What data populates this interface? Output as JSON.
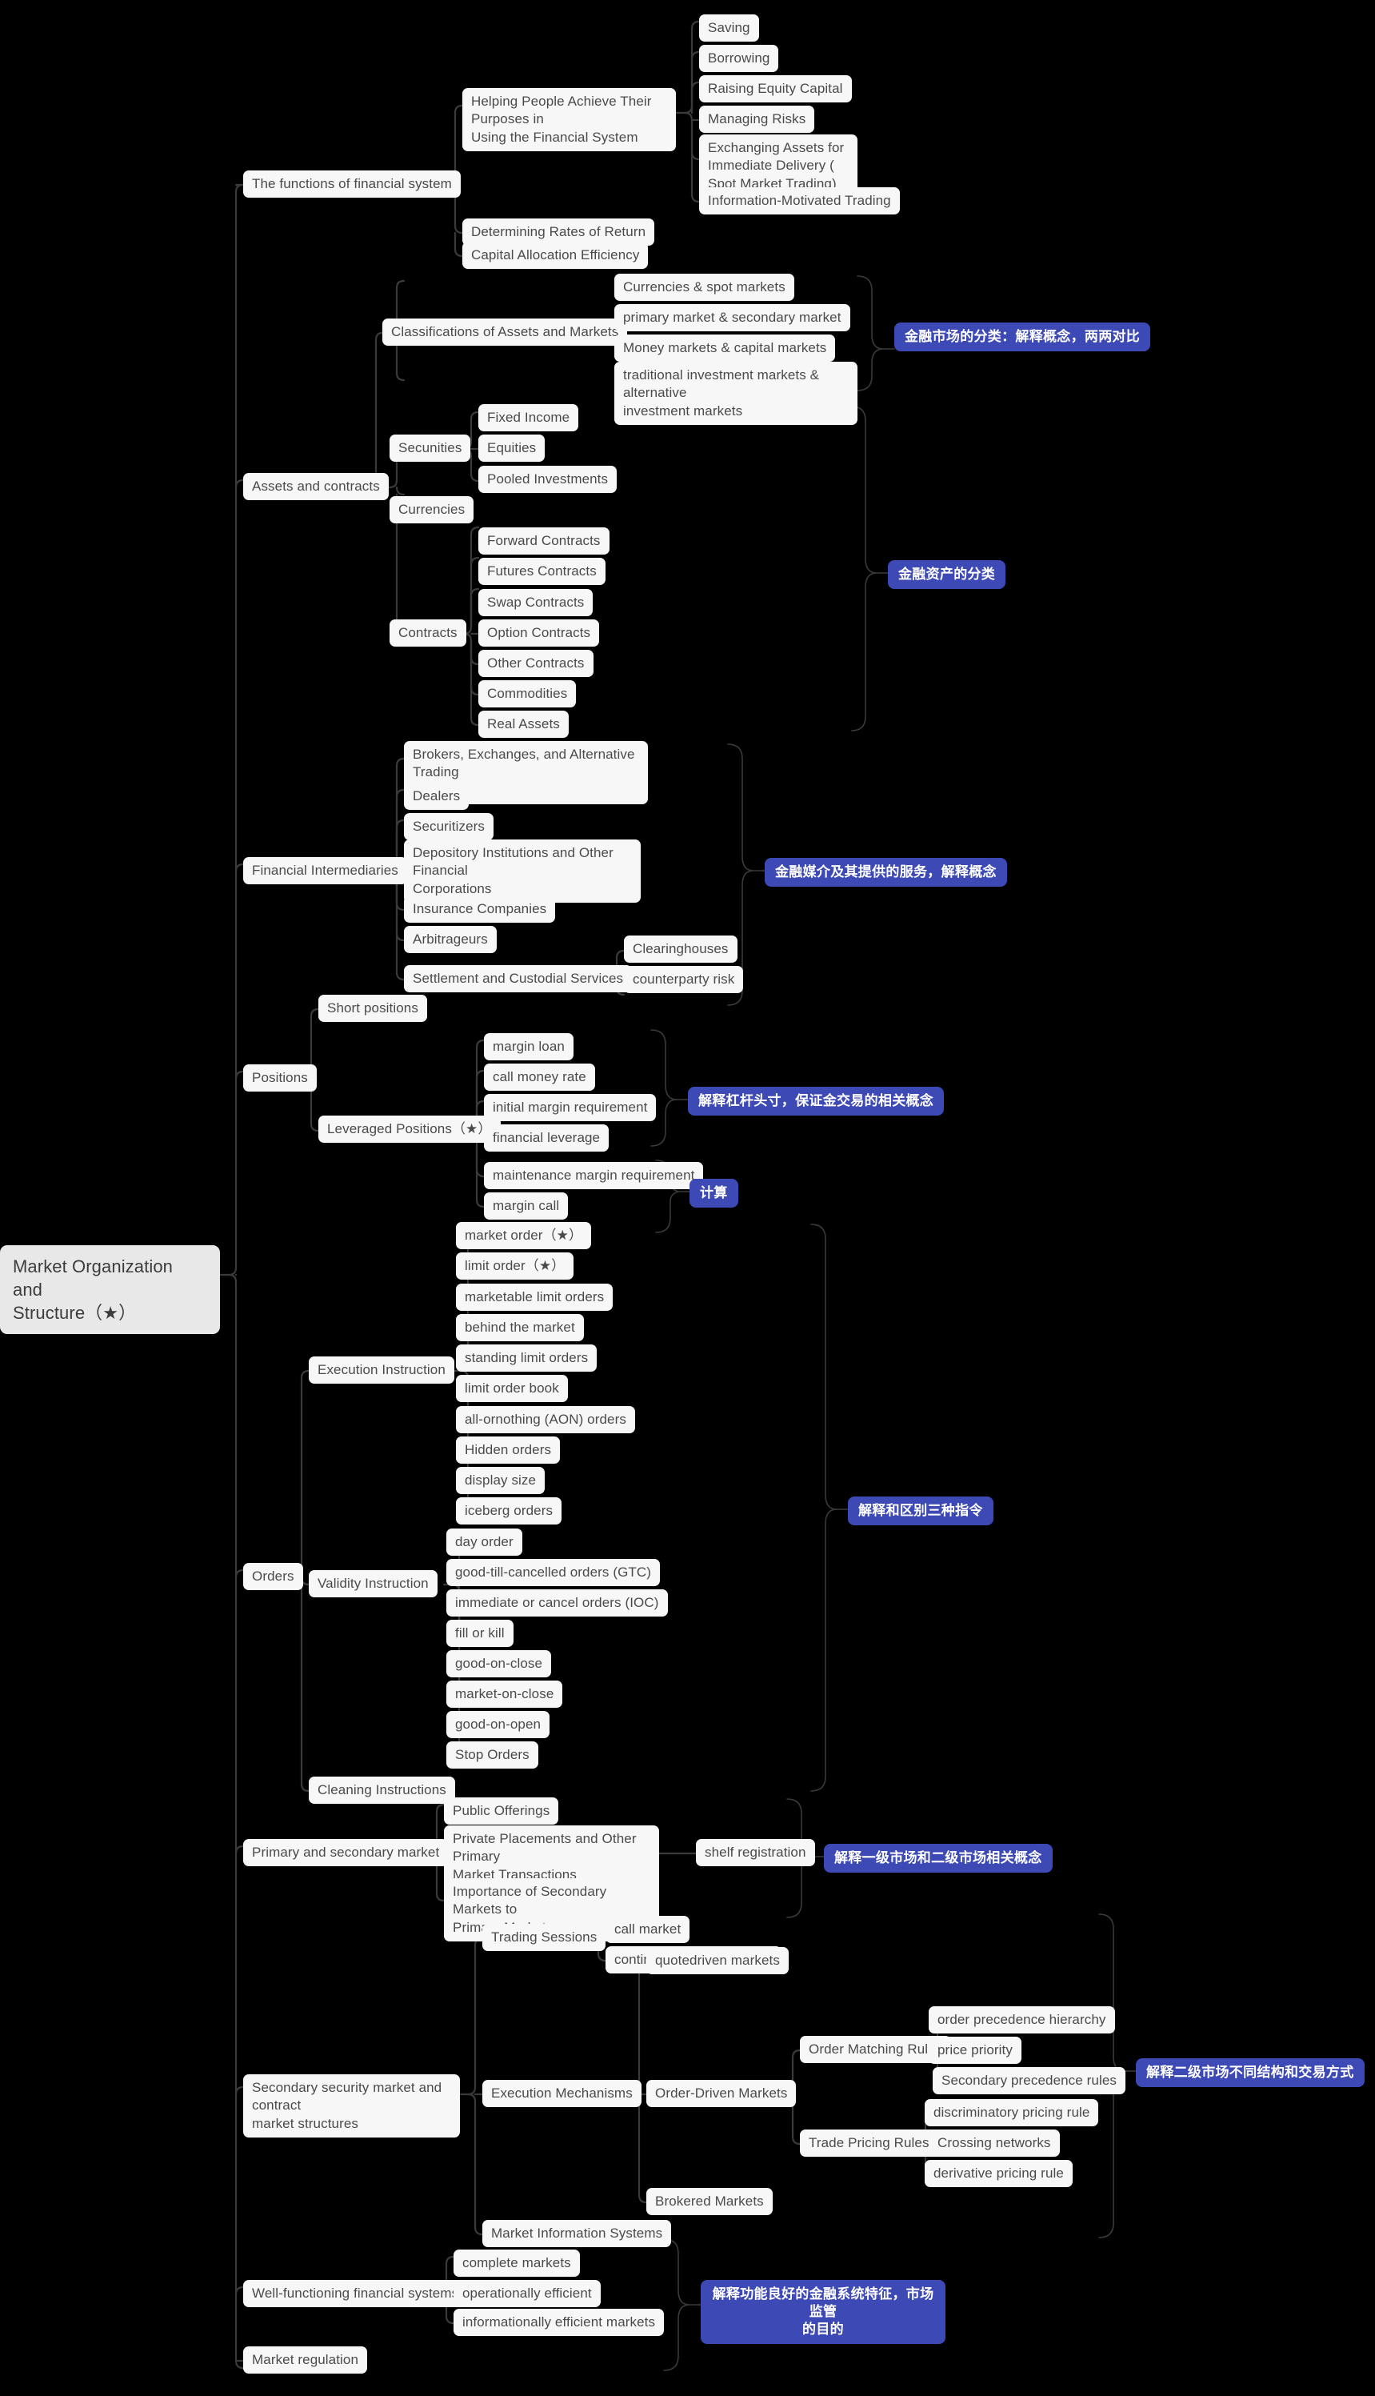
{
  "diagram": {
    "title": "Market Organization and Structure（★）",
    "type": "mindmap",
    "background_color": "#000000",
    "node_color": "#f7f7f7",
    "root_color": "#e8e8e8",
    "badge_color": "#3d49b5",
    "edge_color": "#3a3a3a"
  },
  "root": {
    "label": "Market Organization and\nStructure（★）"
  },
  "nodes": {
    "functions": {
      "label": "The functions of financial system"
    },
    "helping": {
      "label": "Helping People Achieve Their Purposes in\nUsing the Financial System"
    },
    "saving": {
      "label": "Saving"
    },
    "borrowing": {
      "label": "Borrowing"
    },
    "raising_equity": {
      "label": "Raising Equity Capital"
    },
    "managing_risks": {
      "label": "Managing Risks"
    },
    "exchanging": {
      "label": "Exchanging Assets for Immediate Delivery (\nSpot Market Trading)"
    },
    "info_trading": {
      "label": "Information-Motivated Trading"
    },
    "determining_rates": {
      "label": "Determining Rates of Return"
    },
    "capital_alloc": {
      "label": "Capital Allocation Efficiency"
    },
    "classifications": {
      "label": "Classifications of Assets and Markets"
    },
    "currencies_spot": {
      "label": "Currencies &  spot markets"
    },
    "primary_secondary": {
      "label": "primary market & secondary market"
    },
    "money_capital": {
      "label": "Money markets & capital markets"
    },
    "traditional_alt": {
      "label": "traditional investment markets & alternative\ninvestment markets"
    },
    "assets_contracts": {
      "label": "Assets and contracts"
    },
    "securities": {
      "label": "Secunities"
    },
    "fixed_income": {
      "label": "Fixed Income"
    },
    "equities": {
      "label": "Equities"
    },
    "pooled": {
      "label": "Pooled Investments"
    },
    "currencies": {
      "label": "Currencies"
    },
    "contracts": {
      "label": "Contracts"
    },
    "forward": {
      "label": "Forward Contracts"
    },
    "futures": {
      "label": "Futures Contracts"
    },
    "swap": {
      "label": "Swap Contracts"
    },
    "option": {
      "label": "Option Contracts"
    },
    "other_contracts": {
      "label": "Other Contracts"
    },
    "commodities": {
      "label": "Commodities"
    },
    "real_assets": {
      "label": "Real Assets"
    },
    "intermediaries": {
      "label": "Financial Intermediaries"
    },
    "brokers": {
      "label": "Brokers, Exchanges, and Alternative Trading\nSystems"
    },
    "dealers": {
      "label": "Dealers"
    },
    "securitizers": {
      "label": "Securitizers"
    },
    "depository": {
      "label": "Depository Institutions and Other Financial\nCorporations"
    },
    "insurance": {
      "label": "Insurance Companies"
    },
    "arbitrageurs": {
      "label": "Arbitrageurs"
    },
    "settlement": {
      "label": "Settlement and Custodial Services"
    },
    "clearinghouses": {
      "label": "Clearinghouses"
    },
    "counterparty": {
      "label": "counterparty risk"
    },
    "positions": {
      "label": "Positions"
    },
    "short_positions": {
      "label": "Short positions"
    },
    "leveraged": {
      "label": "Leveraged Positions（★）"
    },
    "margin_loan": {
      "label": "margin loan"
    },
    "call_money_rate": {
      "label": "call money rate"
    },
    "initial_margin": {
      "label": "initial margin requirement"
    },
    "fin_leverage": {
      "label": "financial leverage"
    },
    "maintenance_margin": {
      "label": "maintenance margin requirement"
    },
    "margin_call": {
      "label": "margin call"
    },
    "orders": {
      "label": "Orders"
    },
    "exec_instruction": {
      "label": "Execution Instruction"
    },
    "market_order": {
      "label": "market order（★）"
    },
    "limit_order": {
      "label": "limit order（★）"
    },
    "marketable_limit": {
      "label": "marketable limit orders"
    },
    "behind_market": {
      "label": "behind the market"
    },
    "standing_limit": {
      "label": "standing limit orders"
    },
    "limit_order_book": {
      "label": "limit order book"
    },
    "aon": {
      "label": "all-ornothing (AON) orders"
    },
    "hidden_orders": {
      "label": "Hidden orders"
    },
    "display_size": {
      "label": "display size"
    },
    "iceberg": {
      "label": "iceberg orders"
    },
    "validity_instruction": {
      "label": "Validity Instruction"
    },
    "day_order": {
      "label": "day order"
    },
    "gtc": {
      "label": "good-till-cancelled orders (GTC)"
    },
    "ioc": {
      "label": "immediate or cancel orders (IOC)"
    },
    "fill_or_kill": {
      "label": "fill or kill"
    },
    "good_on_close": {
      "label": "good-on-close"
    },
    "market_on_close": {
      "label": "market-on-close"
    },
    "good_on_open": {
      "label": "good-on-open"
    },
    "stop_orders": {
      "label": "Stop Orders"
    },
    "cleaning_instructions": {
      "label": "Cleaning Instructions"
    },
    "primary_sec_market": {
      "label": "Primary and secondary market"
    },
    "public_offerings": {
      "label": "Public Offerings"
    },
    "private_placements": {
      "label": "Private Placements and Other Primary\nMarket Transactions"
    },
    "shelf_registration": {
      "label": "shelf registration"
    },
    "importance_secondary": {
      "label": "Importance of Secondary Markets to\nPrimary Markets"
    },
    "secondary_structures": {
      "label": "Secondary security market and contract\nmarket structures"
    },
    "trading_sessions": {
      "label": "Trading Sessions"
    },
    "call_market": {
      "label": "call market"
    },
    "continuous_trading": {
      "label": "continuous trading market"
    },
    "exec_mechanisms": {
      "label": "Execution Mechanisms"
    },
    "quotedriven": {
      "label": "quotedriven markets"
    },
    "order_driven": {
      "label": "Order-Driven Markets"
    },
    "order_matching": {
      "label": "Order Matching Rules"
    },
    "order_precedence": {
      "label": "order precedence hierarchy"
    },
    "price_priority": {
      "label": "price priority"
    },
    "secondary_precedence": {
      "label": "Secondary precedence rules"
    },
    "trade_pricing": {
      "label": "Trade Pricing Rules"
    },
    "discriminatory": {
      "label": "discriminatory pricing rule"
    },
    "crossing_networks": {
      "label": "Crossing networks"
    },
    "derivative_pricing": {
      "label": "derivative pricing rule"
    },
    "brokered_markets": {
      "label": "Brokered Markets"
    },
    "market_info_systems": {
      "label": "Market Information Systems"
    },
    "well_functioning": {
      "label": "Well-functioning financial systems"
    },
    "complete_markets": {
      "label": "complete markets"
    },
    "operationally_efficient": {
      "label": "operationally efficient"
    },
    "informationally_efficient": {
      "label": "informationally efficient markets"
    },
    "market_regulation": {
      "label": "Market regulation"
    }
  },
  "badges": {
    "market_classification": {
      "label": "金融市场的分类：解释概念，两两对比"
    },
    "asset_classification": {
      "label": "金融资产的分类"
    },
    "intermediaries_services": {
      "label": "金融媒介及其提供的服务，解释概念"
    },
    "leverage_margin": {
      "label": "解释杠杆头寸，保证金交易的相关概念"
    },
    "calculation": {
      "label": "计算"
    },
    "three_orders": {
      "label": "解释和区别三种指令"
    },
    "primary_secondary_concepts": {
      "label": "解释一级市场和二级市场相关概念"
    },
    "secondary_structures_trading": {
      "label": "解释二级市场不同结构和交易方式"
    },
    "well_functioning_regulation": {
      "label": "解释功能良好的金融系统特征，市场监管\n的目的"
    }
  }
}
